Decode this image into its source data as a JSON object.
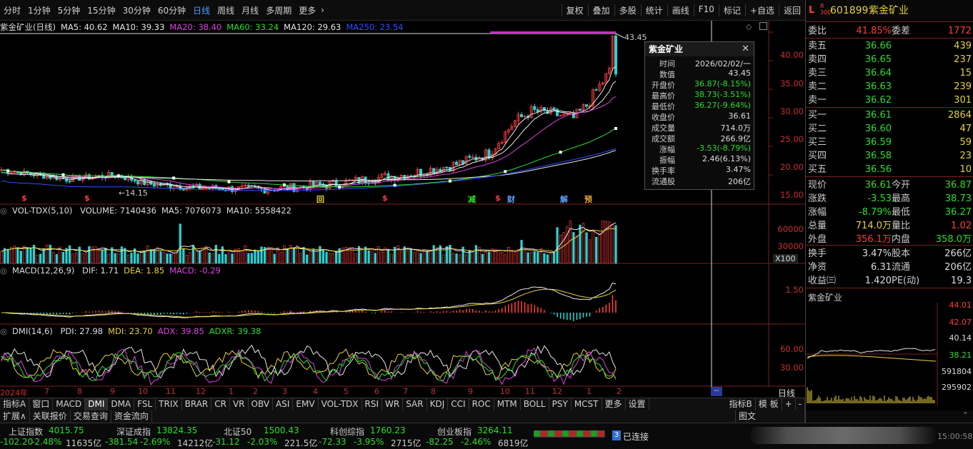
{
  "toolbar": {
    "periods": [
      "分时",
      "1分钟",
      "5分钟",
      "15分钟",
      "30分钟",
      "60分钟",
      "日线",
      "周线",
      "月线",
      "多周期",
      "更多"
    ],
    "active": "日线",
    "right": [
      "复权",
      "叠加",
      "多股",
      "统计",
      "画线",
      "F10",
      "标记",
      "+自选",
      "返回"
    ]
  },
  "main": {
    "title": "紫金矿业(日线)",
    "ma": [
      {
        "t": "MA5: 40.62",
        "c": "#e8e8e8"
      },
      {
        "t": "MA10: 39.33",
        "c": "#e8e8e8"
      },
      {
        "t": "MA20: 38.40",
        "c": "#e040e0"
      },
      {
        "t": "MA60: 33.24",
        "c": "#2adf2a"
      },
      {
        "t": "MA120: 29.63",
        "c": "#e8e8e8"
      },
      {
        "t": "MA250: 23.54",
        "c": "#3050ff"
      }
    ],
    "scale": [
      "40.00",
      "35.00",
      "30.00",
      "25.00",
      "20.00",
      "15.00"
    ],
    "high_label": "43.45",
    "low_label": "14.15",
    "markers": [
      {
        "t": "$",
        "c": "#ff3c3c"
      },
      {
        "t": "$",
        "c": "#ff3c3c"
      },
      {
        "t": "回",
        "c": "#e6d23a"
      },
      {
        "t": "$",
        "c": "#ff3c3c"
      },
      {
        "t": "减",
        "c": "#2adf2a"
      },
      {
        "t": "$",
        "c": "#ff3c3c"
      },
      {
        "t": "财",
        "c": "#5aa0ff"
      },
      {
        "t": "解",
        "c": "#5aa0ff"
      },
      {
        "t": "预",
        "c": "#e6a23a"
      }
    ]
  },
  "vol": {
    "title": "VOL-TDX(5,10)",
    "items": [
      "VOLUME: 7140436",
      "MA5: 7076073",
      "MA10: 5558422"
    ],
    "scale": [
      "60000",
      "30000"
    ],
    "unit": "X100"
  },
  "macd": {
    "title": "MACD(12,26,9)",
    "items": [
      "DIF: 1.71",
      "DEA: 1.85",
      "MACD: -0.29"
    ],
    "scale": [
      "1.50"
    ]
  },
  "dmi": {
    "title": "DMI(14,6)",
    "items": [
      "PDI: 27.98",
      "MDI: 23.70",
      "ADX: 39.85",
      "ADXR: 39.38"
    ],
    "scale": [
      "60.00",
      "30.00"
    ]
  },
  "xaxis": {
    "labels": [
      "2024年",
      "7",
      "8",
      "9",
      "10",
      "11",
      "12",
      "1",
      "2",
      "3",
      "4",
      "5",
      "6",
      "7",
      "8",
      "9",
      "10",
      "11",
      "12",
      "1",
      "2"
    ],
    "right": "日线",
    "cursor": "--"
  },
  "tooltip": {
    "title": "紫金矿业",
    "rows": [
      {
        "l": "时间",
        "v": "2026/02/02/一",
        "c": "#ddd"
      },
      {
        "l": "数值",
        "v": "43.45",
        "c": "#ddd"
      },
      {
        "l": "开盘价",
        "v": "36.87(-8.15%)",
        "c": "#2adf2a"
      },
      {
        "l": "最高价",
        "v": "38.73(-3.51%)",
        "c": "#2adf2a"
      },
      {
        "l": "最低价",
        "v": "36.27(-9.64%)",
        "c": "#2adf2a"
      },
      {
        "l": "收盘价",
        "v": "36.61",
        "c": "#ddd"
      },
      {
        "l": "成交量",
        "v": "714.0万",
        "c": "#ddd"
      },
      {
        "l": "成交额",
        "v": "266.9亿",
        "c": "#ddd"
      },
      {
        "l": "涨幅",
        "v": "-3.53(-8.79%)",
        "c": "#2adf2a"
      },
      {
        "l": "振幅",
        "v": "2.46(6.13%)",
        "c": "#ddd"
      },
      {
        "l": "换手率",
        "v": "3.47%",
        "c": "#ddd"
      },
      {
        "l": "流通股",
        "v": "206亿",
        "c": "#ddd"
      }
    ]
  },
  "tabs": [
    "指标A",
    "窗口",
    "MACD",
    "DMI",
    "DMA",
    "FSL",
    "TRIX",
    "BRAR",
    "CR",
    "VR",
    "OBV",
    "ASI",
    "EMV",
    "VOL-TDX",
    "RSI",
    "WR",
    "SAR",
    "KDJ",
    "CCI",
    "ROC",
    "MTM",
    "BOLL",
    "PSY",
    "MCST",
    "更多",
    "设置"
  ],
  "tabs_active": "DMI",
  "tabs_right": [
    "指标B",
    "模 板",
    "+",
    "-"
  ],
  "tabs2": [
    "扩展∧",
    "关联报价",
    "交易查询",
    "资金流向"
  ],
  "tabs2_right": "图文",
  "stock": {
    "code": "601899",
    "name": "紫金矿业",
    "badge": "L",
    "sub": "R 300",
    "ratio": {
      "l": "委比",
      "v": "41.85%",
      "l2": "委差",
      "v2": "1772"
    },
    "asks": [
      {
        "l": "卖五",
        "p": "36.66",
        "q": "439"
      },
      {
        "l": "卖四",
        "p": "36.65",
        "q": "237"
      },
      {
        "l": "卖三",
        "p": "36.64",
        "q": "15"
      },
      {
        "l": "卖二",
        "p": "36.63",
        "q": "239"
      },
      {
        "l": "卖一",
        "p": "36.62",
        "q": "301"
      }
    ],
    "bids": [
      {
        "l": "买一",
        "p": "36.61",
        "q": "2864"
      },
      {
        "l": "买二",
        "p": "36.60",
        "q": "47"
      },
      {
        "l": "买三",
        "p": "36.59",
        "q": "59"
      },
      {
        "l": "买四",
        "p": "36.58",
        "q": "23"
      },
      {
        "l": "买五",
        "p": "36.56",
        "q": "10"
      }
    ],
    "stats": [
      {
        "l": "现价",
        "v": "36.61",
        "vc": "green",
        "l2": "今开",
        "v2": "36.87",
        "v2c": "green"
      },
      {
        "l": "涨跌",
        "v": "-3.53",
        "vc": "green",
        "l2": "最高",
        "v2": "38.73",
        "v2c": "green"
      },
      {
        "l": "涨幅",
        "v": "-8.79%",
        "vc": "green",
        "l2": "最低",
        "v2": "36.27",
        "v2c": "green"
      },
      {
        "l": "总量",
        "v": "714.0万",
        "vc": "yellow",
        "l2": "量比",
        "v2": "1.02",
        "v2c": "red"
      },
      {
        "l": "外盘",
        "v": "356.1万",
        "vc": "red",
        "l2": "内盘",
        "v2": "358.0万",
        "v2c": "green"
      }
    ],
    "stats2": [
      {
        "l": "换手",
        "v": "3.47%",
        "l2": "股本",
        "v2": "266亿"
      },
      {
        "l": "净资",
        "v": "6.31",
        "l2": "流通",
        "v2": "206亿"
      },
      {
        "l": "收益㈢",
        "v": "1.420",
        "l2": "PE(动)",
        "v2": "19.3"
      }
    ],
    "mini_title": "紫金矿业",
    "mini_scale": [
      "44.01",
      "42.07",
      "40.14",
      "38.21",
      "591804",
      "295902"
    ]
  },
  "status": {
    "indices": [
      {
        "n": "上证指数",
        "v": "4015.75",
        "c": "-102.20",
        "p": "-2.48%",
        "a": "11635亿"
      },
      {
        "n": "深证成指",
        "v": "13824.35",
        "c": "-381.54",
        "p": "-2.69%",
        "a": "14212亿"
      },
      {
        "n": "北证50",
        "v": "1500.43",
        "c": "-31.12",
        "p": "-2.03%",
        "a": "221.5亿"
      },
      {
        "n": "科创综指",
        "v": "1760.23",
        "c": "-72.33",
        "p": "-3.95%",
        "a": "2715亿"
      },
      {
        "n": "创业板指",
        "v": "3264.11",
        "c": "-82.25",
        "p": "-2.46%",
        "a": "6819亿"
      }
    ],
    "conn_num": "3",
    "conn": "已连接",
    "time": "15:00:58"
  }
}
